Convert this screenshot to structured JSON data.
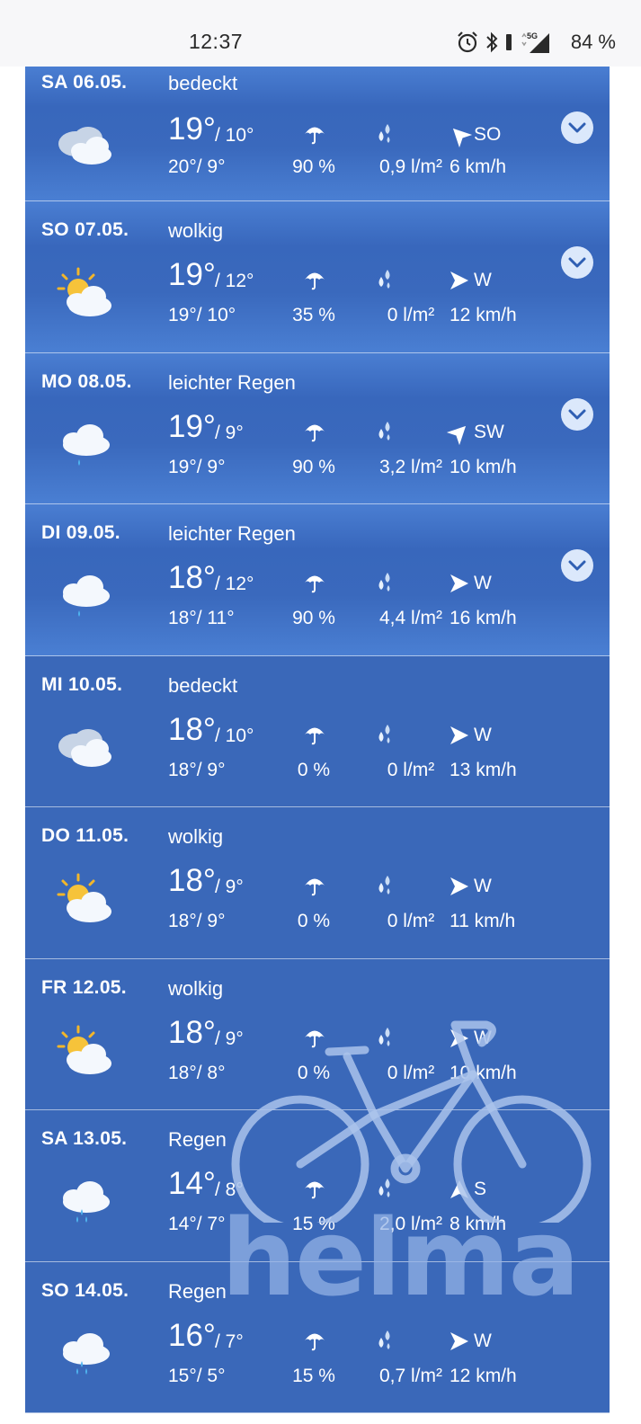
{
  "status": {
    "time": "12:37",
    "battery": "84 %",
    "network": "5G"
  },
  "days": [
    {
      "date": "SA 06.05.",
      "condition": "bedeckt",
      "icon": "overcast-cloud-icon",
      "tmax": "19°",
      "tmin": "/ 10°",
      "feels": "20°/ 9°",
      "precip_prob": "90 %",
      "precip_amount": "0,9 l/m²",
      "wind_dir": "SO",
      "wind_speed": "6 km/h",
      "expandable": true
    },
    {
      "date": "SO 07.05.",
      "condition": "wolkig",
      "icon": "sun-cloud-icon",
      "tmax": "19°",
      "tmin": "/ 12°",
      "feels": "19°/ 10°",
      "precip_prob": "35 %",
      "precip_amount": "0 l/m²",
      "wind_dir": "W",
      "wind_speed": "12 km/h",
      "expandable": true
    },
    {
      "date": "MO 08.05.",
      "condition": "leichter Regen",
      "icon": "light-rain-icon",
      "tmax": "19°",
      "tmin": "/ 9°",
      "feels": "19°/ 9°",
      "precip_prob": "90 %",
      "precip_amount": "3,2 l/m²",
      "wind_dir": "SW",
      "wind_speed": "10 km/h",
      "expandable": true
    },
    {
      "date": "DI 09.05.",
      "condition": "leichter Regen",
      "icon": "light-rain-icon",
      "tmax": "18°",
      "tmin": "/ 12°",
      "feels": "18°/ 11°",
      "precip_prob": "90 %",
      "precip_amount": "4,4 l/m²",
      "wind_dir": "W",
      "wind_speed": "16 km/h",
      "expandable": true
    },
    {
      "date": "MI 10.05.",
      "condition": "bedeckt",
      "icon": "overcast-cloud-icon",
      "tmax": "18°",
      "tmin": "/ 10°",
      "feels": "18°/ 9°",
      "precip_prob": "0 %",
      "precip_amount": "0 l/m²",
      "wind_dir": "W",
      "wind_speed": "13 km/h",
      "expandable": false
    },
    {
      "date": "DO 11.05.",
      "condition": "wolkig",
      "icon": "sun-cloud-icon",
      "tmax": "18°",
      "tmin": "/ 9°",
      "feels": "18°/ 9°",
      "precip_prob": "0 %",
      "precip_amount": "0 l/m²",
      "wind_dir": "W",
      "wind_speed": "11 km/h",
      "expandable": false
    },
    {
      "date": "FR 12.05.",
      "condition": "wolkig",
      "icon": "sun-cloud-icon",
      "tmax": "18°",
      "tmin": "/ 9°",
      "feels": "18°/ 8°",
      "precip_prob": "0 %",
      "precip_amount": "0 l/m²",
      "wind_dir": "W",
      "wind_speed": "10 km/h",
      "expandable": false
    },
    {
      "date": "SA 13.05.",
      "condition": "Regen",
      "icon": "rain-icon",
      "tmax": "14°",
      "tmin": "/ 8°",
      "feels": "14°/ 7°",
      "precip_prob": "15 %",
      "precip_amount": "2,0 l/m²",
      "wind_dir": "S",
      "wind_speed": "8 km/h",
      "expandable": false
    },
    {
      "date": "SO 14.05.",
      "condition": "Regen",
      "icon": "rain-icon",
      "tmax": "16°",
      "tmin": "/ 7°",
      "feels": "15°/ 5°",
      "precip_prob": "15 %",
      "precip_amount": "0,7 l/m²",
      "wind_dir": "W",
      "wind_speed": "12 km/h",
      "expandable": false
    }
  ],
  "watermark": {
    "text": "helma",
    "icon": "bicycle-icon"
  },
  "colors": {
    "card_blue": "#3a68b9",
    "card_gradient_light": "#4a7ed2",
    "chevron_bg": "#dbe8fb",
    "status_bg": "#f7f7f9"
  }
}
